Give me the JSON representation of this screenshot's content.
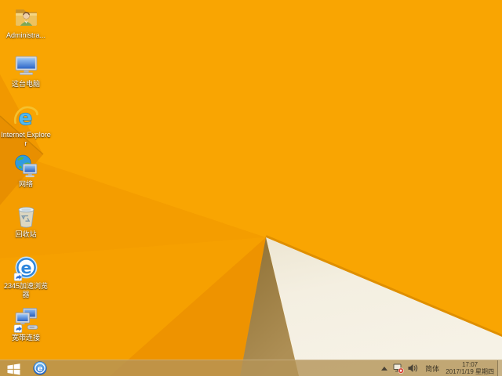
{
  "desktop": {
    "icons": [
      {
        "id": "administrator-folder",
        "label": "Administra..."
      },
      {
        "id": "this-pc",
        "label": "这台电脑"
      },
      {
        "id": "internet-explorer",
        "label": "Internet Explorer"
      },
      {
        "id": "network",
        "label": "网络"
      },
      {
        "id": "recycle-bin",
        "label": "回收站"
      },
      {
        "id": "browser-2345",
        "label": "2345加速浏览器"
      },
      {
        "id": "broadband-connection",
        "label": "宽带连接"
      }
    ]
  },
  "taskbar": {
    "pinned_app_icon": "browser-2345-icon",
    "tray": {
      "hidden_icons_arrow": "up-arrow-icon",
      "network_status_icon": "network-disconnected-icon",
      "volume_icon": "speaker-icon",
      "ime_label": "简体",
      "time": "17:07",
      "date": "2017/1/19 星期四"
    }
  },
  "colors": {
    "wallpaper_orange": "#F8A201",
    "wallpaper_orange_deep": "#EE9300",
    "wallpaper_fold_dark": "#E88F00",
    "wallpaper_tan_triangle": "#9E7C3E",
    "wallpaper_cream_triangle": "#F3EEDF",
    "taskbar_tint": "#C29B52",
    "tray_text": "#3E3726",
    "icon_label_text": "#FFFFFF"
  }
}
